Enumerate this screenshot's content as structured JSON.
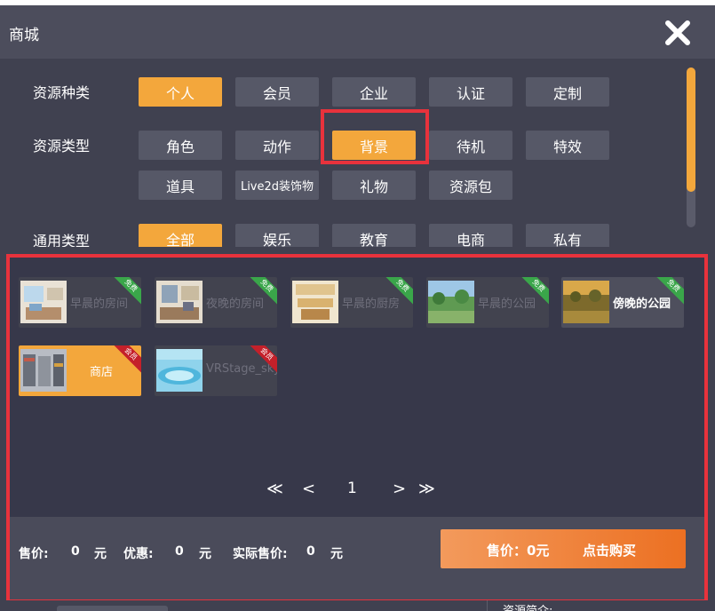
{
  "window": {
    "title": "商城"
  },
  "filters": {
    "resource_category": {
      "label": "资源种类",
      "options": [
        "个人",
        "会员",
        "企业",
        "认证",
        "定制"
      ],
      "selected": "个人"
    },
    "resource_type": {
      "label": "资源类型",
      "options": [
        "角色",
        "动作",
        "背景",
        "待机",
        "特效",
        "道具",
        "Live2d装饰物",
        "礼物",
        "资源包"
      ],
      "selected": "背景"
    },
    "general_type": {
      "label": "通用类型",
      "options": [
        "全部",
        "娱乐",
        "教育",
        "电商",
        "私有"
      ],
      "selected": "全部"
    }
  },
  "items": [
    {
      "name": "早晨的房间",
      "badge": "免费",
      "badge_color": "#3aa64a"
    },
    {
      "name": "夜晚的房间",
      "badge": "免费",
      "badge_color": "#3aa64a"
    },
    {
      "name": "早晨的厨房",
      "badge": "免费",
      "badge_color": "#3aa64a"
    },
    {
      "name": "早晨的公园",
      "badge": "免费",
      "badge_color": "#3aa64a"
    },
    {
      "name": "傍晚的公园",
      "badge": "免费",
      "badge_color": "#3aa64a"
    },
    {
      "name": "商店",
      "badge": "会员",
      "badge_color": "#c4202a",
      "selected": true
    },
    {
      "name": "VRStage_sky",
      "badge": "会员",
      "badge_color": "#c4202a"
    }
  ],
  "pagination": {
    "first": "≪",
    "prev": "<",
    "current": "1",
    "next": ">",
    "last": "≫"
  },
  "price": {
    "price_label": "售价:",
    "price_value": "0",
    "price_unit": "元",
    "discount_label": "优惠:",
    "discount_value": "0",
    "discount_unit": "元",
    "actual_label": "实际售价:",
    "actual_value": "0",
    "actual_unit": "元"
  },
  "buy_button": {
    "price_text": "售价：0元",
    "action_text": "点击购买"
  },
  "footer": {
    "resource_intro_label": "资源简介:"
  },
  "colors": {
    "accent": "#f3a73c",
    "highlight": "#e8323c",
    "free": "#3aa64a",
    "member": "#c4202a"
  }
}
